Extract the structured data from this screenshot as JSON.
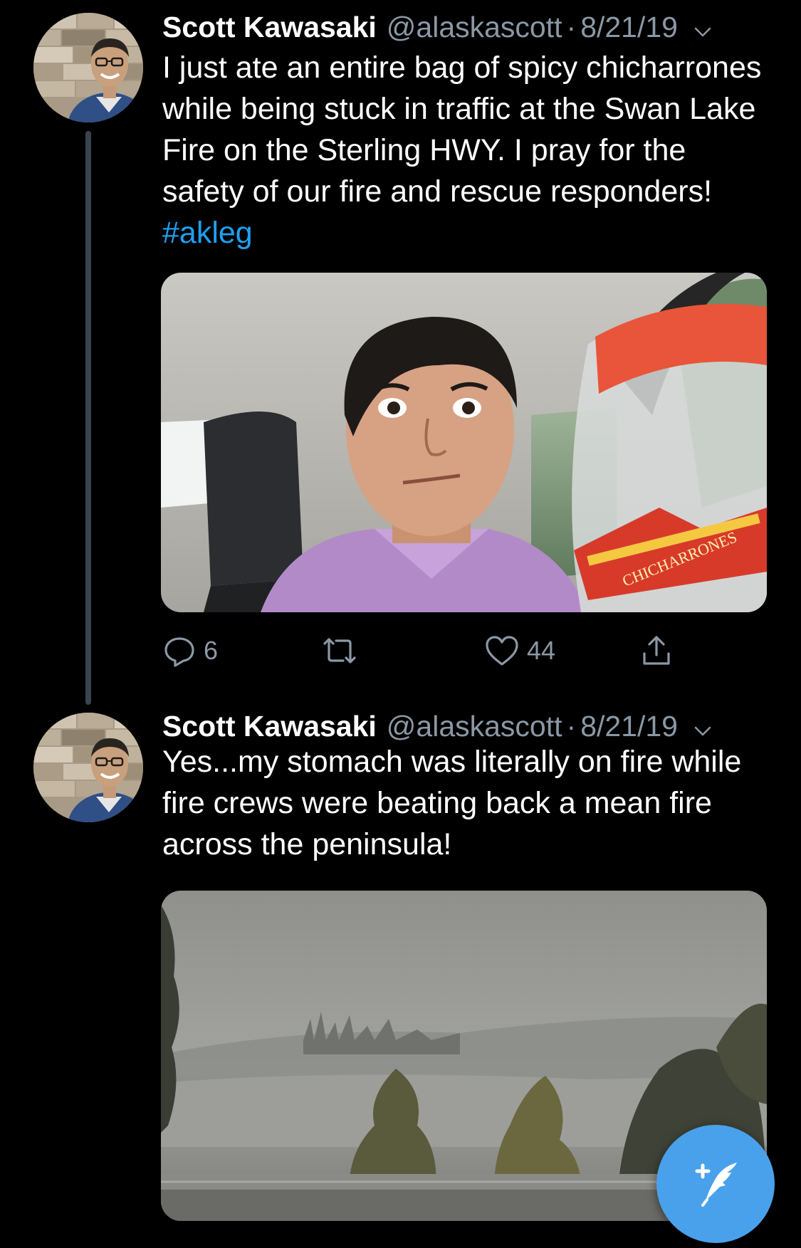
{
  "tweets": [
    {
      "author": {
        "name": "Scott Kawasaki",
        "handle": "@alaskascott",
        "separator": "·",
        "date": "8/21/19"
      },
      "text": "I just ate an entire bag of spicy chicharrones while being stuck in traffic at the Swan Lake Fire on the Sterling HWY. I pray for the safety of our fire and rescue responders! ",
      "hashtag": "#akleg",
      "media": {
        "bag_label": "CHICHARRONES"
      },
      "actions": {
        "reply_count": "6",
        "retweet_count": "",
        "like_count": "44"
      }
    },
    {
      "author": {
        "name": "Scott Kawasaki",
        "handle": "@alaskascott",
        "separator": "·",
        "date": "8/21/19"
      },
      "text": "Yes...my stomach was literally on fire while fire crews were beating back a mean fire across the peninsula!"
    }
  ],
  "colors": {
    "background": "#000000",
    "text": "#ffffff",
    "secondary_text": "#8b98a5",
    "link": "#1da1f2",
    "thread_line": "#3a4450",
    "fab": "#4aa1eb"
  },
  "icons": {
    "reply": "reply-icon",
    "retweet": "retweet-icon",
    "like": "like-icon",
    "share": "share-icon",
    "caret": "chevron-down-icon",
    "compose": "compose-tweet-icon"
  }
}
